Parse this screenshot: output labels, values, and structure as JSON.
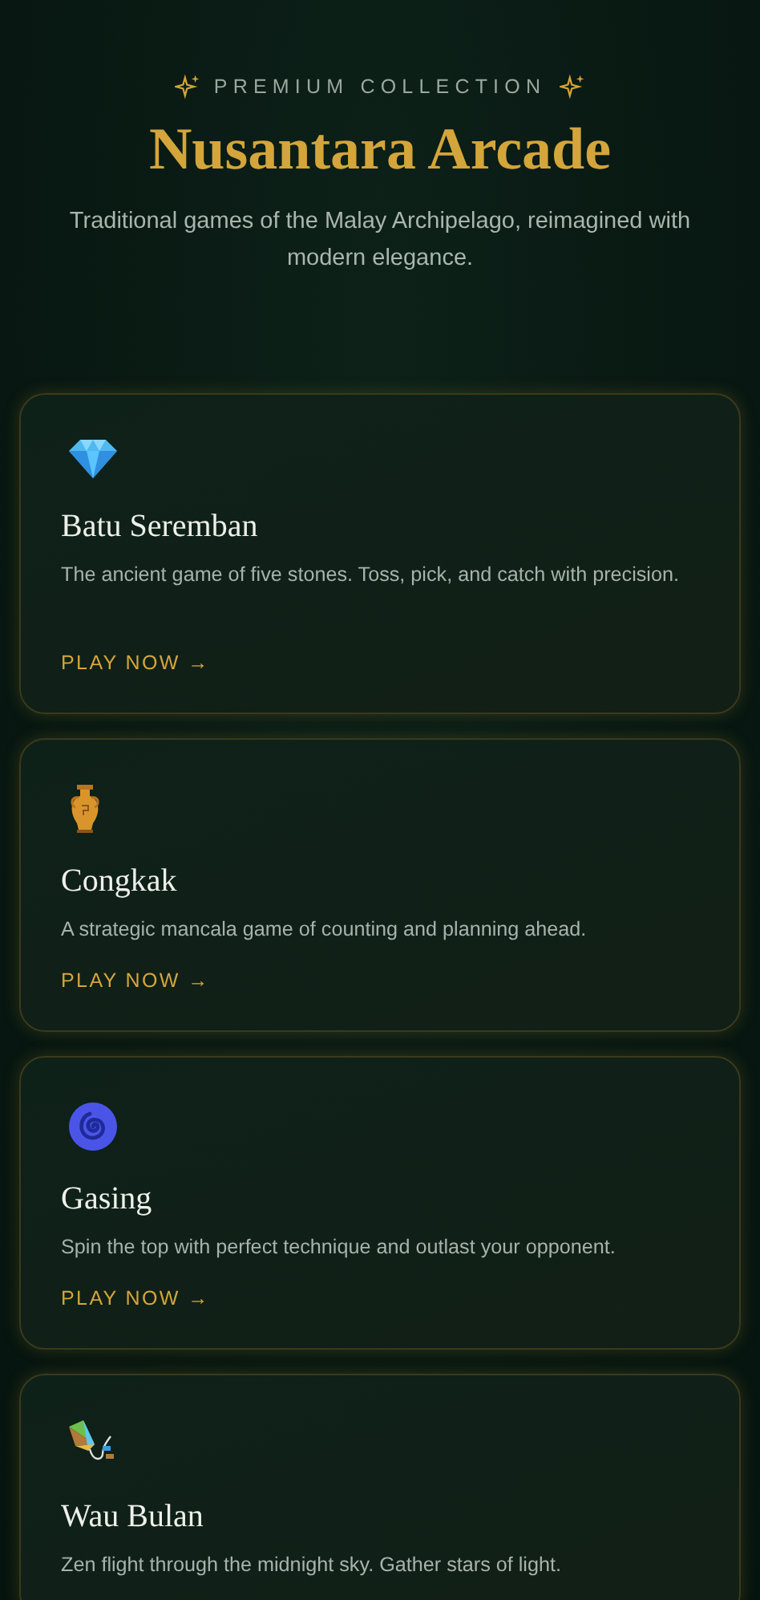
{
  "header": {
    "eyebrow": "PREMIUM COLLECTION",
    "title": "Nusantara Arcade",
    "subtitle": "Traditional games of the Malay Archipelago, reimagined with modern elegance."
  },
  "games": [
    {
      "kind": "gem",
      "title": "Batu Seremban",
      "description": "The ancient game of five stones. Toss, pick, and catch with precision.",
      "cta": "PLAY NOW →"
    },
    {
      "kind": "vase",
      "title": "Congkak",
      "description": "A strategic mancala game of counting and planning ahead.",
      "cta": "PLAY NOW →"
    },
    {
      "kind": "spiral",
      "title": "Gasing",
      "description": "Spin the top with perfect technique and outlast your opponent.",
      "cta": "PLAY NOW →"
    },
    {
      "kind": "kite",
      "title": "Wau Bulan",
      "description": "Zen flight through the midnight sky. Gather stars of light."
    }
  ]
}
